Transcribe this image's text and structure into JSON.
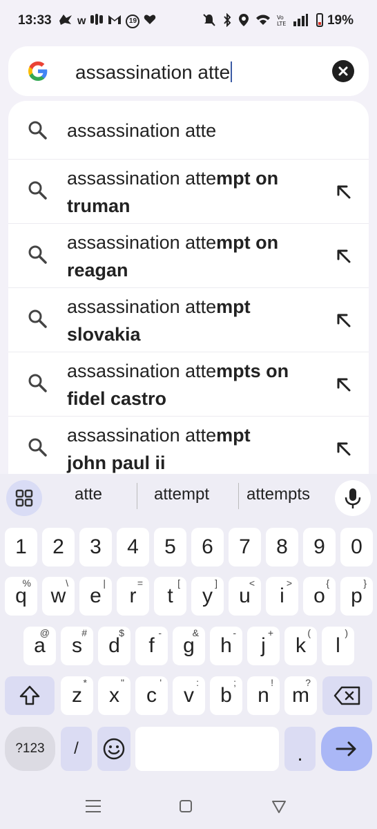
{
  "status_bar": {
    "time": "13:33",
    "notification_icons": [
      "bird-icon",
      "w-icon",
      "audio-icon",
      "gmail-icon",
      "19-badge-icon",
      "heart-icon"
    ],
    "w_label": "w",
    "badge_label": "19",
    "battery_percent": "19%"
  },
  "search": {
    "query": "assassination atte"
  },
  "suggestions": [
    {
      "prefix": "assassination atte",
      "completion": "",
      "rest": "",
      "has_arrow": false
    },
    {
      "prefix": "assassination atte",
      "completion": "mpt on",
      "rest": "truman",
      "has_arrow": true
    },
    {
      "prefix": "assassination atte",
      "completion": "mpt on",
      "rest": "reagan",
      "has_arrow": true
    },
    {
      "prefix": "assassination atte",
      "completion": "mpt",
      "rest": "slovakia",
      "has_arrow": true
    },
    {
      "prefix": "assassination atte",
      "completion": "mpts on",
      "rest": "fidel castro",
      "has_arrow": true
    },
    {
      "prefix": "assassination atte",
      "completion": "mpt",
      "rest": "john paul ii",
      "has_arrow": true
    }
  ],
  "keyboard": {
    "word_suggestions": [
      "atte",
      "attempt",
      "attempts"
    ],
    "row_numbers": [
      "1",
      "2",
      "3",
      "4",
      "5",
      "6",
      "7",
      "8",
      "9",
      "0"
    ],
    "row_q": [
      {
        "k": "q",
        "s": "%"
      },
      {
        "k": "w",
        "s": "\\"
      },
      {
        "k": "e",
        "s": "|"
      },
      {
        "k": "r",
        "s": "="
      },
      {
        "k": "t",
        "s": "["
      },
      {
        "k": "y",
        "s": "]"
      },
      {
        "k": "u",
        "s": "<"
      },
      {
        "k": "i",
        "s": ">"
      },
      {
        "k": "o",
        "s": "{"
      },
      {
        "k": "p",
        "s": "}"
      }
    ],
    "row_a": [
      {
        "k": "a",
        "s": "@"
      },
      {
        "k": "s",
        "s": "#"
      },
      {
        "k": "d",
        "s": "$"
      },
      {
        "k": "f",
        "s": "-"
      },
      {
        "k": "g",
        "s": "&"
      },
      {
        "k": "h",
        "s": "-"
      },
      {
        "k": "j",
        "s": "+"
      },
      {
        "k": "k",
        "s": "("
      },
      {
        "k": "l",
        "s": ")"
      }
    ],
    "row_z": [
      {
        "k": "z",
        "s": "*"
      },
      {
        "k": "x",
        "s": "\""
      },
      {
        "k": "c",
        "s": "'"
      },
      {
        "k": "v",
        "s": ":"
      },
      {
        "k": "b",
        "s": ";"
      },
      {
        "k": "n",
        "s": "!"
      },
      {
        "k": "m",
        "s": "?"
      }
    ],
    "symbols_label": "?123",
    "slash_label": "/",
    "period_label": "."
  },
  "colors": {
    "accent": "#aab7f6",
    "mod_key": "#dbdcf3",
    "background": "#f3f1f8"
  }
}
